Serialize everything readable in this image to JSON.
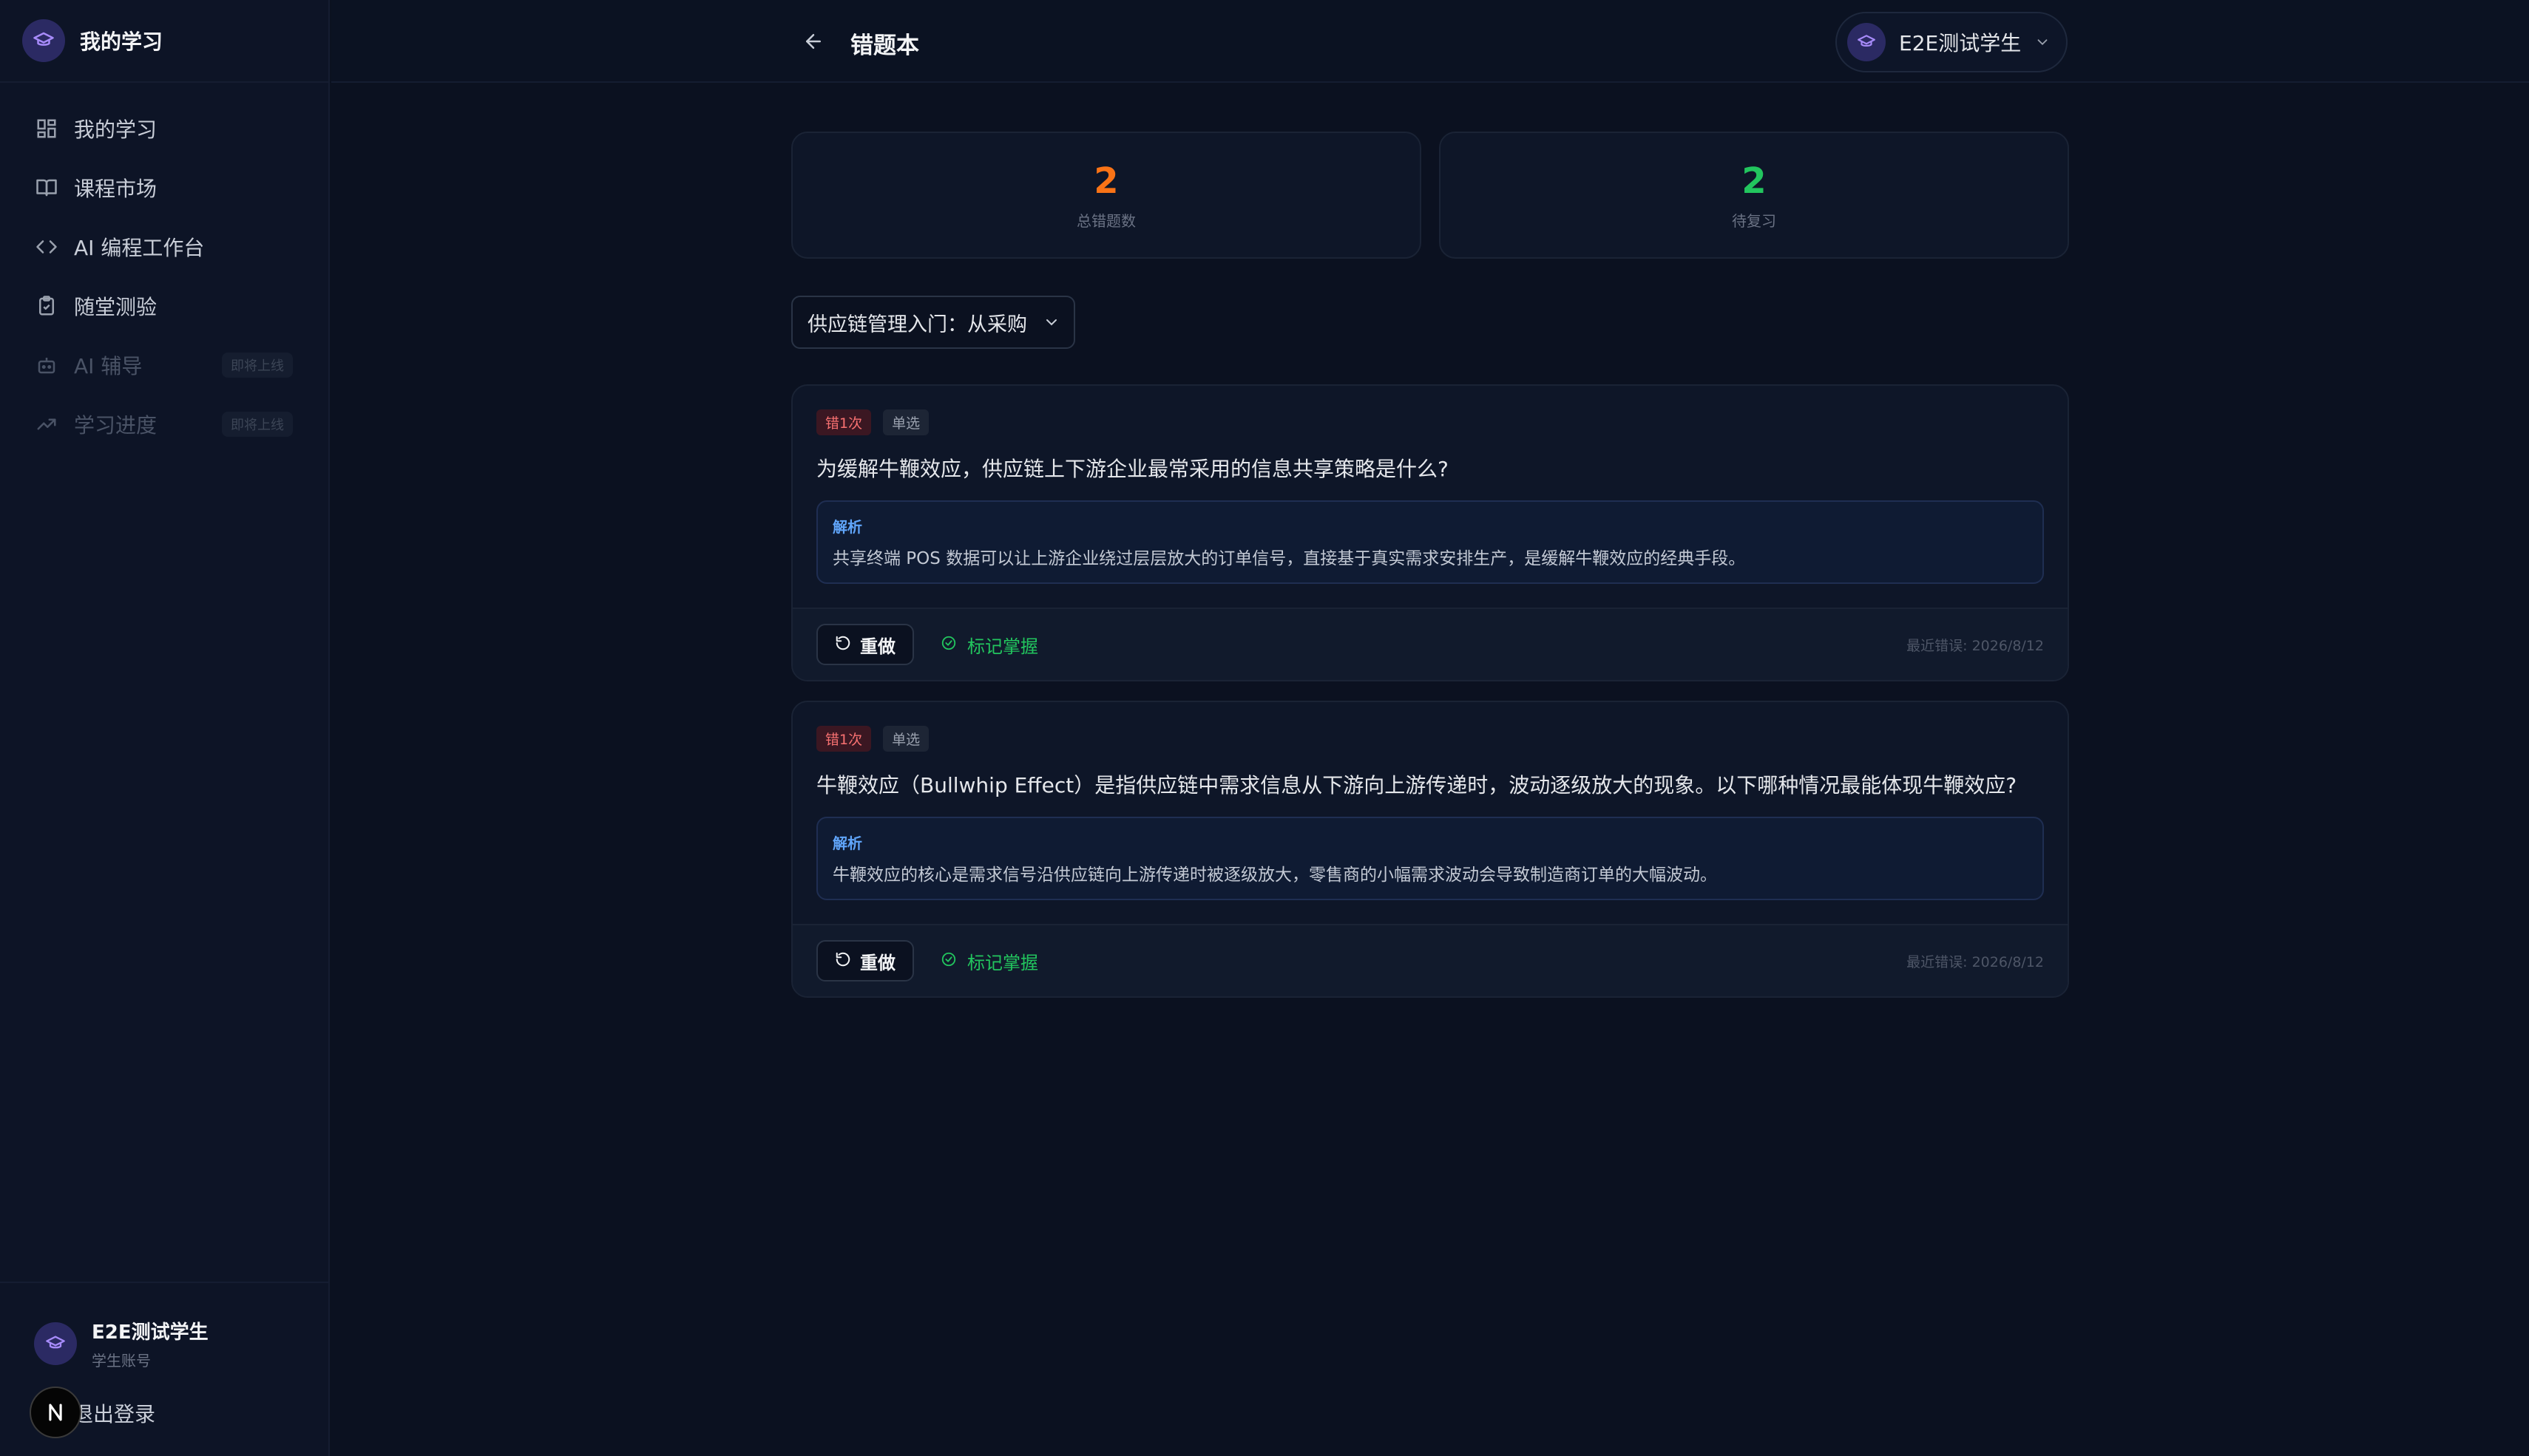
{
  "brand": {
    "title": "我的学习",
    "icon": "graduation-cap-icon"
  },
  "sidebar": {
    "items": [
      {
        "label": "我的学习",
        "icon": "grid-icon"
      },
      {
        "label": "课程市场",
        "icon": "book-open-icon"
      },
      {
        "label": "AI 编程工作台",
        "icon": "code-icon"
      },
      {
        "label": "随堂测验",
        "icon": "clipboard-check-icon"
      },
      {
        "label": "AI 辅导",
        "icon": "bot-icon",
        "badge": "即将上线"
      },
      {
        "label": "学习进度",
        "icon": "trending-up-icon",
        "badge": "即将上线"
      }
    ],
    "user": {
      "name": "E2E测试学生",
      "role": "学生账号"
    },
    "logout_label": "退出登录"
  },
  "header": {
    "title": "错题本",
    "user_name": "E2E测试学生"
  },
  "stats": [
    {
      "value": "2",
      "label": "总错题数",
      "color": "#f97316"
    },
    {
      "value": "2",
      "label": "待复习",
      "color": "#22c55e"
    }
  ],
  "course_select": {
    "value": "供应链管理入门：从采购"
  },
  "questions": [
    {
      "wrong_tag": "错1次",
      "type_tag": "单选",
      "text": "为缓解牛鞭效应，供应链上下游企业最常采用的信息共享策略是什么?",
      "explain_title": "解析",
      "explain_text": "共享终端 POS 数据可以让上游企业绕过层层放大的订单信号，直接基于真实需求安排生产，是缓解牛鞭效应的经典手段。",
      "redo_label": "重做",
      "master_label": "标记掌握",
      "last_wrong": "最近错误: 2026/8/12"
    },
    {
      "wrong_tag": "错1次",
      "type_tag": "单选",
      "text": "牛鞭效应（Bullwhip Effect）是指供应链中需求信息从下游向上游传递时，波动逐级放大的现象。以下哪种情况最能体现牛鞭效应?",
      "explain_title": "解析",
      "explain_text": "牛鞭效应的核心是需求信号沿供应链向上游传递时被逐级放大，零售商的小幅需求波动会导致制造商订单的大幅波动。",
      "redo_label": "重做",
      "master_label": "标记掌握",
      "last_wrong": "最近错误: 2026/8/12"
    }
  ],
  "colors": {
    "background": "#0b1120",
    "accent_orange": "#f97316",
    "accent_green": "#22c55e",
    "explain_blue": "#60a5fa",
    "wrong_red": "#f87171"
  }
}
